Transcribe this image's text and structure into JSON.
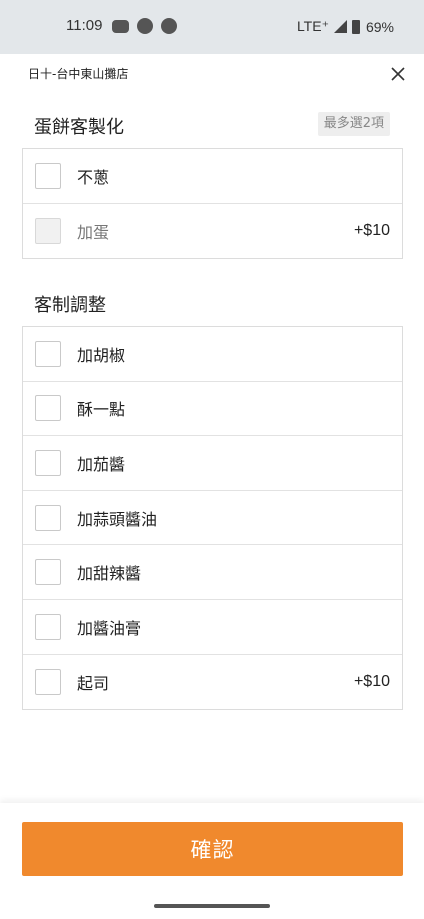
{
  "status_bar": {
    "time": "11:09",
    "network": "LTE⁺",
    "battery": "69%"
  },
  "header": {
    "store_name": "日十-台中東山攤店"
  },
  "section_egg": {
    "title": "蛋餅客製化",
    "limit": "最多選2項",
    "options": [
      {
        "label": "不蔥",
        "price": "",
        "disabled": false
      },
      {
        "label": "加蛋",
        "price": "+$10",
        "disabled": true
      }
    ]
  },
  "section_custom": {
    "title": "客制調整",
    "options": [
      {
        "label": "加胡椒",
        "price": ""
      },
      {
        "label": "酥一點",
        "price": ""
      },
      {
        "label": "加茄醬",
        "price": ""
      },
      {
        "label": "加蒜頭醬油",
        "price": ""
      },
      {
        "label": "加甜辣醬",
        "price": ""
      },
      {
        "label": "加醬油膏",
        "price": ""
      },
      {
        "label": "起司",
        "price": "+$10"
      }
    ]
  },
  "footer": {
    "confirm_label": "確認",
    "accent_color": "#f0892d"
  }
}
